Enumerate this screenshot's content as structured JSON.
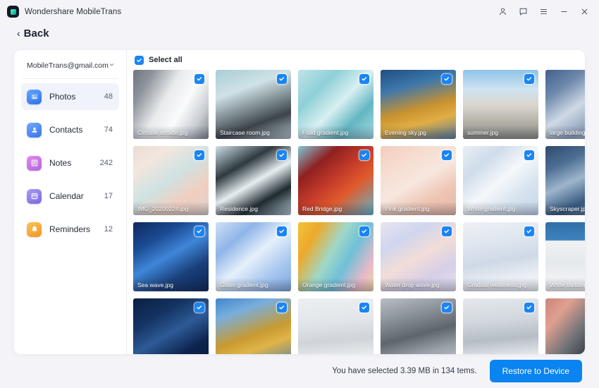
{
  "titlebar": {
    "app_name": "Wondershare MobileTrans",
    "logo_icon": "app-logo-icon",
    "controls": [
      {
        "name": "account-icon",
        "glyph": "person"
      },
      {
        "name": "feedback-icon",
        "glyph": "chat"
      },
      {
        "name": "menu-icon",
        "glyph": "hamburger"
      },
      {
        "name": "minimize-button",
        "glyph": "minus"
      },
      {
        "name": "close-button",
        "glyph": "cross"
      }
    ]
  },
  "nav": {
    "back_label": "Back",
    "back_chevron": "‹"
  },
  "sidebar": {
    "account_email": "MobileTrans@gmail.com",
    "account_chevron": "⌄",
    "items": [
      {
        "label": "Photos",
        "count": "48",
        "icon": "photos-icon",
        "active": true
      },
      {
        "label": "Contacts",
        "count": "74",
        "icon": "contacts-icon",
        "active": false
      },
      {
        "label": "Notes",
        "count": "242",
        "icon": "notes-icon",
        "active": false
      },
      {
        "label": "Calendar",
        "count": "17",
        "icon": "calendar-icon",
        "active": false
      },
      {
        "label": "Reminders",
        "count": "12",
        "icon": "reminders-icon",
        "active": false
      }
    ]
  },
  "content": {
    "select_all_label": "Select all",
    "select_all_checked": true,
    "photos": [
      {
        "name": "Circular arcade.jpg",
        "selected": true,
        "art": "a1"
      },
      {
        "name": "Staircase room.jpg",
        "selected": true,
        "art": "a2"
      },
      {
        "name": "Fluid gradient.jpg",
        "selected": true,
        "art": "a3"
      },
      {
        "name": "Evening sky.jpg",
        "selected": true,
        "art": "a4"
      },
      {
        "name": "summer.jpg",
        "selected": true,
        "art": "a5"
      },
      {
        "name": "large building.jpg",
        "selected": true,
        "art": "a6"
      },
      {
        "name": "IMG_20200224.jpg",
        "selected": true,
        "art": "b1"
      },
      {
        "name": "Residence.jpg",
        "selected": true,
        "art": "b2"
      },
      {
        "name": "Red Bridge.jpg",
        "selected": true,
        "art": "b3"
      },
      {
        "name": "Pink gradient.jpg",
        "selected": true,
        "art": "b4"
      },
      {
        "name": "White gradient.jpg",
        "selected": true,
        "art": "b5"
      },
      {
        "name": "Skyscraper.jpg",
        "selected": true,
        "art": "b6"
      },
      {
        "name": "Sea wave.jpg",
        "selected": true,
        "art": "c1"
      },
      {
        "name": "Glass gradient.jpg",
        "selected": true,
        "art": "c2"
      },
      {
        "name": "Orange gradient.jpg",
        "selected": true,
        "art": "c3"
      },
      {
        "name": "Water drop wave.jpg",
        "selected": true,
        "art": "c4"
      },
      {
        "name": "Gradual weakness.jpg",
        "selected": true,
        "art": "c5"
      },
      {
        "name": "White building.jpg",
        "selected": true,
        "art": "c6"
      },
      {
        "name": "",
        "selected": true,
        "art": "d1"
      },
      {
        "name": "",
        "selected": true,
        "art": "d2"
      },
      {
        "name": "",
        "selected": true,
        "art": "d3"
      },
      {
        "name": "",
        "selected": true,
        "art": "d4"
      },
      {
        "name": "",
        "selected": true,
        "art": "d5"
      },
      {
        "name": "",
        "selected": true,
        "art": "d6"
      }
    ]
  },
  "footer": {
    "summary": "You have selected 3.39 MB in 134 tems.",
    "restore_label": "Restore to Device"
  },
  "colors": {
    "accent": "#0a84f0",
    "checkbox": "#1a85f5",
    "window_bg": "#f4f4f8",
    "card_bg": "#ffffff"
  }
}
